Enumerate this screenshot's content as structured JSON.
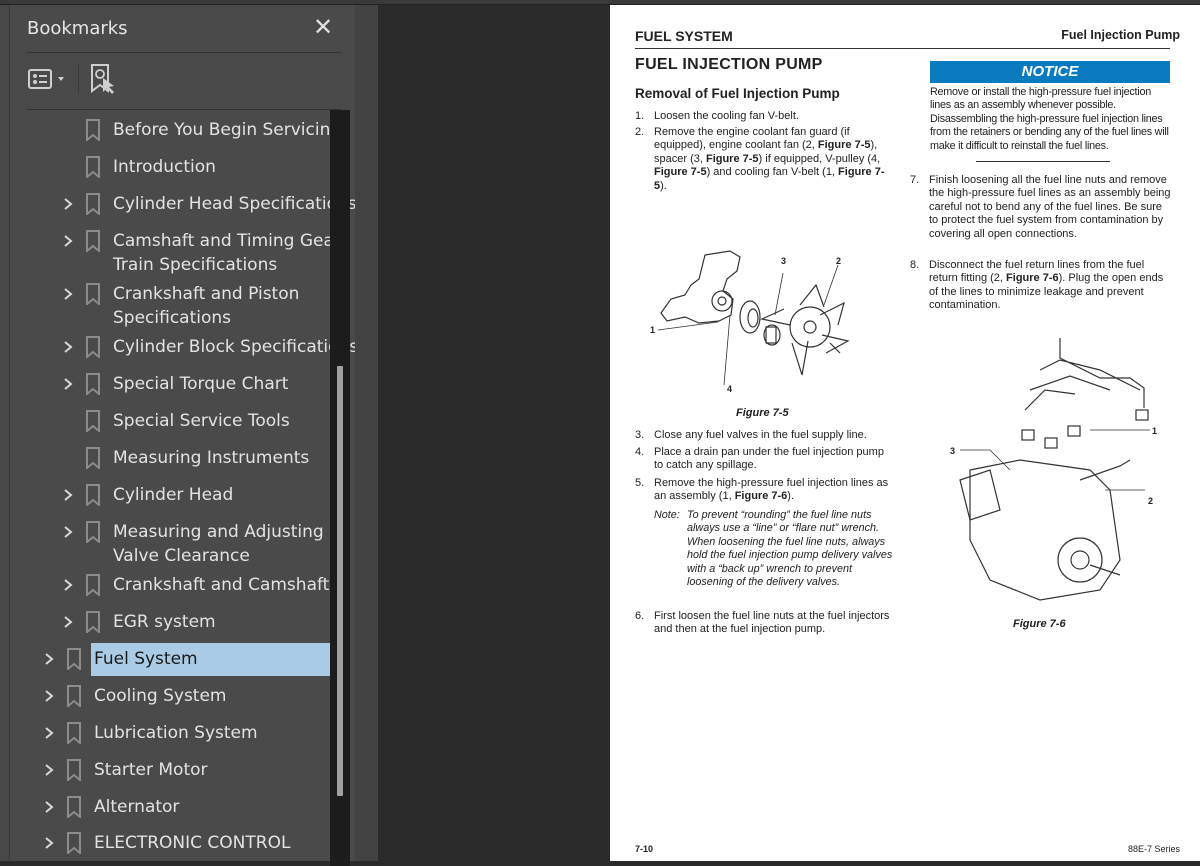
{
  "panel": {
    "title": "Bookmarks",
    "close_icon": "close-icon",
    "options_icon": "bookmark-options-icon",
    "find_icon": "find-current-bookmark-icon"
  },
  "bookmarks": [
    {
      "label": "Before You Begin Servicing",
      "level": 2,
      "expandable": false
    },
    {
      "label": "Introduction",
      "level": 2,
      "expandable": false
    },
    {
      "label": "Cylinder Head Specifications",
      "level": 2,
      "expandable": true
    },
    {
      "label": "Camshaft and Timing Gear",
      "label2": "Train Specifications",
      "level": 2,
      "expandable": true
    },
    {
      "label": "Crankshaft and Piston",
      "label2": "Specifications",
      "level": 2,
      "expandable": true
    },
    {
      "label": "Cylinder Block Specifications",
      "level": 2,
      "expandable": true
    },
    {
      "label": "Special Torque Chart",
      "level": 2,
      "expandable": true
    },
    {
      "label": "Special Service Tools",
      "level": 2,
      "expandable": false
    },
    {
      "label": "Measuring Instruments",
      "level": 2,
      "expandable": false
    },
    {
      "label": "Cylinder Head",
      "level": 2,
      "expandable": true
    },
    {
      "label": "Measuring and Adjusting",
      "label2": "Valve Clearance",
      "level": 2,
      "expandable": true
    },
    {
      "label": "Crankshaft and Camshaft",
      "level": 2,
      "expandable": true
    },
    {
      "label": "EGR system",
      "level": 2,
      "expandable": true
    },
    {
      "label": "Fuel System",
      "level": 1,
      "expandable": true,
      "selected": true
    },
    {
      "label": "Cooling System",
      "level": 1,
      "expandable": true
    },
    {
      "label": "Lubrication System",
      "level": 1,
      "expandable": true
    },
    {
      "label": "Starter Motor",
      "level": 1,
      "expandable": true
    },
    {
      "label": "Alternator",
      "level": 1,
      "expandable": true
    },
    {
      "label": "ELECTRONIC CONTROL",
      "level": 1,
      "expandable": true
    }
  ],
  "colors": {
    "selected_bg": "#a9cbe6",
    "notice_bg": "#0a7bc1",
    "panel_bg": "#4a4a4a",
    "canvas_bg": "#2a2a2a"
  },
  "document": {
    "header_left": "FUEL SYSTEM",
    "header_right": "Fuel Injection Pump",
    "title": "FUEL INJECTION PUMP",
    "subtitle": "Removal of Fuel Injection Pump",
    "notice_label": "NOTICE",
    "notice_text": "Remove or install the high-pressure fuel injection lines as an assembly whenever possible. Disassembling the high-pressure fuel injection lines from the retainers or bending any of the fuel lines will make it difficult to reinstall the fuel lines.",
    "steps": [
      {
        "n": "1.",
        "text": "Loosen the cooling fan V-belt."
      },
      {
        "n": "2.",
        "text": "Remove the engine coolant fan guard (if equipped), engine coolant fan (2, <b>Figure 7-5</b>), spacer (3, <b>Figure 7-5</b>) if equipped, V-pulley (4, <b>Figure 7-5</b>) and cooling fan V-belt (1, <b>Figure 7-5</b>)."
      },
      {
        "n": "3.",
        "text": "Close any fuel valves in the fuel supply line."
      },
      {
        "n": "4.",
        "text": "Place a drain pan under the fuel injection pump to catch any spillage."
      },
      {
        "n": "5.",
        "text": "Remove the high-pressure fuel injection lines as an assembly (1, <b>Figure 7-6</b>)."
      },
      {
        "n": "6.",
        "text": "First loosen the fuel line nuts at the fuel injectors and then at the fuel injection pump."
      },
      {
        "n": "7.",
        "text": "Finish loosening all the fuel line nuts and remove the high-pressure fuel lines as an assembly being careful not to bend any of the fuel lines. Be sure to protect the fuel system from contamination by covering all open connections."
      },
      {
        "n": "8.",
        "text": "Disconnect the fuel return lines from the fuel return fitting (2, <b>Figure 7-6</b>). Plug the open ends of the lines to minimize leakage and prevent contamination."
      }
    ],
    "note_label": "Note:",
    "note_text": "To prevent “rounding” the fuel line nuts always use a “line” or “flare nut” wrench. When loosening the fuel line nuts, always hold the fuel injection pump delivery valves with a “back up” wrench to prevent loosening of the delivery valves.",
    "figure1": {
      "caption": "Figure 7-5",
      "callouts": [
        "1",
        "2",
        "3",
        "4"
      ]
    },
    "figure2": {
      "caption": "Figure 7-6",
      "callouts": [
        "1",
        "2",
        "3"
      ]
    },
    "footer_left": "7-10",
    "footer_right": "88E-7 Series"
  }
}
